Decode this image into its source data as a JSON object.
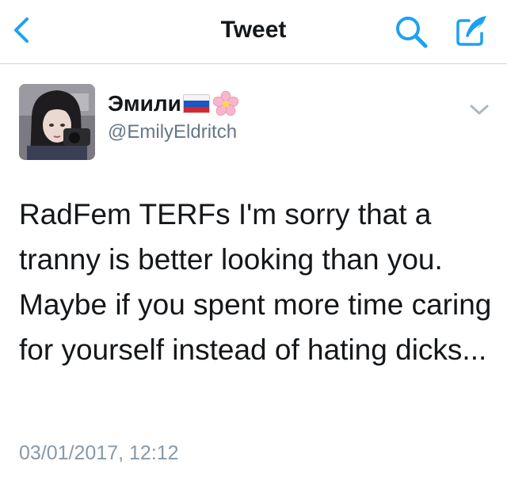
{
  "nav": {
    "title": "Tweet",
    "back_icon": "chevron-left-icon",
    "search_icon": "search-icon",
    "compose_icon": "compose-tweet-icon",
    "accent_color": "#1da1f2"
  },
  "tweet": {
    "author": {
      "display_name": "Эмили",
      "handle": "@EmilyEldritch",
      "emoji": [
        "russian-flag-icon",
        "cherry-blossom-icon"
      ]
    },
    "text": "RadFem TERFs I'm sorry that a tranny is better looking than you. Maybe if you spent more time caring for yourself instead of hating dicks...",
    "timestamp": "03/01/2017, 12:12",
    "more_icon": "chevron-down-icon"
  },
  "colors": {
    "text": "#14171a",
    "secondary": "#657786",
    "timestamp": "#8899a6",
    "divider": "#cfd4d8"
  }
}
